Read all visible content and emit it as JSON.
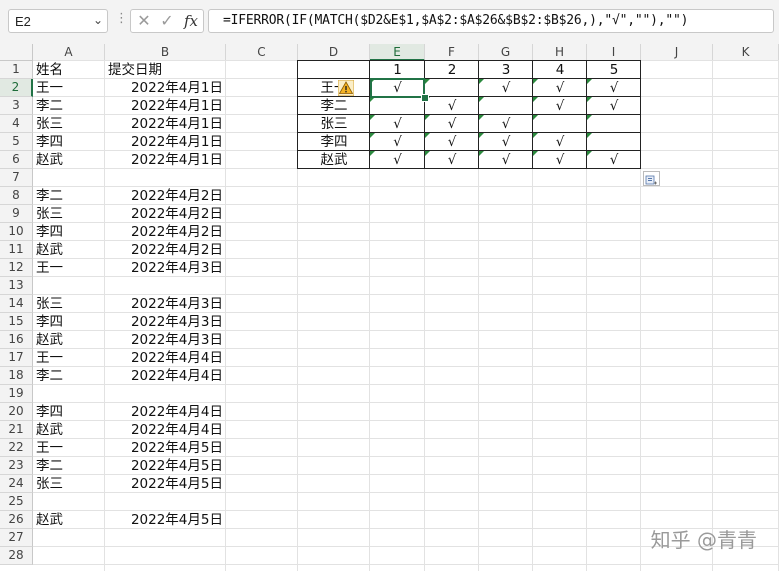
{
  "formula_bar": {
    "name_box": "E2",
    "name_box_arrow": "⌄",
    "vdots": "⋮",
    "cancel": "✕",
    "enter": "✓",
    "fx": "fx",
    "formula": "=IFERROR(IF(MATCH($D2&E$1,$A$2:$A$26&$B$2:$B$26,),\"√\",\"\"),\"\")"
  },
  "columns": [
    "A",
    "B",
    "C",
    "D",
    "E",
    "F",
    "G",
    "H",
    "I",
    "J",
    "K"
  ],
  "rows": [
    "1",
    "2",
    "3",
    "4",
    "5",
    "6",
    "7",
    "8",
    "9",
    "10",
    "11",
    "12",
    "13",
    "14",
    "15",
    "16",
    "17",
    "18",
    "19",
    "20",
    "21",
    "22",
    "23",
    "24",
    "25",
    "26",
    "27",
    "28"
  ],
  "col_a": [
    "姓名",
    "王一",
    "李二",
    "张三",
    "李四",
    "赵武",
    "",
    "李二",
    "张三",
    "李四",
    "赵武",
    "王一",
    "",
    "张三",
    "李四",
    "赵武",
    "王一",
    "李二",
    "",
    "李四",
    "赵武",
    "王一",
    "李二",
    "张三",
    "",
    "赵武",
    "",
    ""
  ],
  "col_b": [
    "提交日期",
    "2022年4月1日",
    "2022年4月1日",
    "2022年4月1日",
    "2022年4月1日",
    "2022年4月1日",
    "",
    "2022年4月2日",
    "2022年4月2日",
    "2022年4月2日",
    "2022年4月2日",
    "2022年4月3日",
    "",
    "2022年4月3日",
    "2022年4月3日",
    "2022年4月3日",
    "2022年4月4日",
    "2022年4月4日",
    "",
    "2022年4月4日",
    "2022年4月4日",
    "2022年4月5日",
    "2022年4月5日",
    "2022年4月5日",
    "",
    "2022年4月5日",
    "",
    ""
  ],
  "summary": {
    "days": [
      "1",
      "2",
      "3",
      "4",
      "5"
    ],
    "names": [
      "王一",
      "李二",
      "张三",
      "李四",
      "赵武"
    ],
    "marks": [
      [
        "√",
        "",
        "√",
        "√",
        "√"
      ],
      [
        "",
        "√",
        "",
        "√",
        "√"
      ],
      [
        "√",
        "√",
        "√",
        "",
        ""
      ],
      [
        "√",
        "√",
        "√",
        "√",
        ""
      ],
      [
        "√",
        "√",
        "√",
        "√",
        "√"
      ]
    ]
  },
  "watermark": "知乎 @青青"
}
